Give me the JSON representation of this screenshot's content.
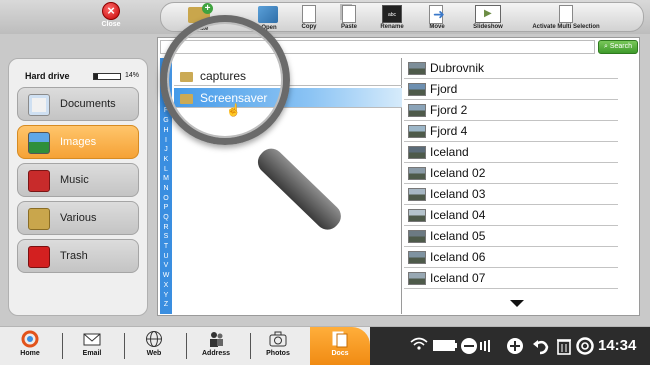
{
  "topbar": {
    "close_label": "Close"
  },
  "toolbar": {
    "create_label": "Create",
    "open_label": "Open",
    "copy_label": "Copy",
    "paste_label": "Paste",
    "rename_label": "Rename",
    "move_label": "Move",
    "slideshow_label": "Slideshow",
    "multi_label": "Activate Multi Selection"
  },
  "sidebar": {
    "drive_label": "Hard drive",
    "drive_percent_text": "14%",
    "drive_fill_fraction": 0.14,
    "items": [
      {
        "label": "Documents",
        "icon": "documents-icon"
      },
      {
        "label": "Images",
        "icon": "images-icon",
        "active": true
      },
      {
        "label": "Music",
        "icon": "music-icon"
      },
      {
        "label": "Various",
        "icon": "various-icon"
      },
      {
        "label": "Trash",
        "icon": "trash-icon"
      }
    ]
  },
  "search": {
    "value": "",
    "button_label": "Search"
  },
  "alphabet": [
    "A",
    "B",
    "C",
    "D",
    "E",
    "F",
    "G",
    "H",
    "I",
    "J",
    "K",
    "L",
    "M",
    "N",
    "O",
    "P",
    "Q",
    "R",
    "S",
    "T",
    "U",
    "V",
    "W",
    "X",
    "Y",
    "Z"
  ],
  "folders": [
    {
      "name": "captures",
      "selected": false
    },
    {
      "name": "Screensaver",
      "selected": true
    }
  ],
  "files": [
    {
      "name": "Dubrovnik"
    },
    {
      "name": "Fjord"
    },
    {
      "name": "Fjord 2"
    },
    {
      "name": "Fjord 4"
    },
    {
      "name": "Iceland"
    },
    {
      "name": "Iceland 02"
    },
    {
      "name": "Iceland 03"
    },
    {
      "name": "Iceland 04"
    },
    {
      "name": "Iceland 05"
    },
    {
      "name": "Iceland 06"
    },
    {
      "name": "Iceland 07"
    }
  ],
  "bottom_nav": {
    "home": "Home",
    "email": "Email",
    "web": "Web",
    "address": "Address",
    "photos": "Photos",
    "docs": "Docs"
  },
  "status": {
    "clock": "14:34"
  },
  "colors": {
    "accent_orange": "#f5a236",
    "selection_blue": "#3a95e8",
    "search_green": "#3f9a2b"
  }
}
